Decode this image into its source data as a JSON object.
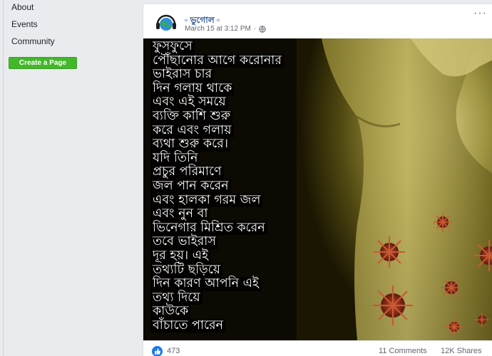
{
  "sidebar": {
    "links": [
      {
        "label": "About"
      },
      {
        "label": "Events"
      },
      {
        "label": "Community"
      }
    ],
    "create_page_label": "Create a Page"
  },
  "post": {
    "page_name": "ভুগোল",
    "timestamp": "March 15 at 3:12 PM",
    "more_label": "···",
    "image_text_lines": [
      "ফুসফুসে",
      "পৌঁছানোর আগে করোনার",
      "ভাইরাস চার",
      "দিন গলায় থাকে",
      "এবং এই সময়ে",
      "ব্যক্তি কাশি শুরু",
      "করে এবং গলায়",
      "ব্যথা শুরু করে।",
      "যদি তিনি",
      "প্রচুর পরিমাণে",
      "জল পান করেন",
      "এবং হালকা গরম জল",
      "এবং নুন বা",
      "ভিনেগার মিশ্রিত করেন",
      "তবে ভাইরাস",
      "দূর হয়। এই",
      "তথ্যটি ছড়িয়ে",
      "দিন কারণ আপনি এই",
      "তথ্য দিয়ে",
      "কাউকে",
      "বাঁচাতে পারেন"
    ],
    "reactions": {
      "count": "473"
    },
    "comments": "11 Comments",
    "shares": "12K Shares"
  },
  "colors": {
    "link_blue": "#365899",
    "create_button_green": "#42b72a",
    "like_blue": "#1877f2"
  },
  "icons": {
    "avatar": "headphones-globe-logo",
    "privacy": "globe-icon",
    "reaction": "thumbs-up-icon"
  }
}
